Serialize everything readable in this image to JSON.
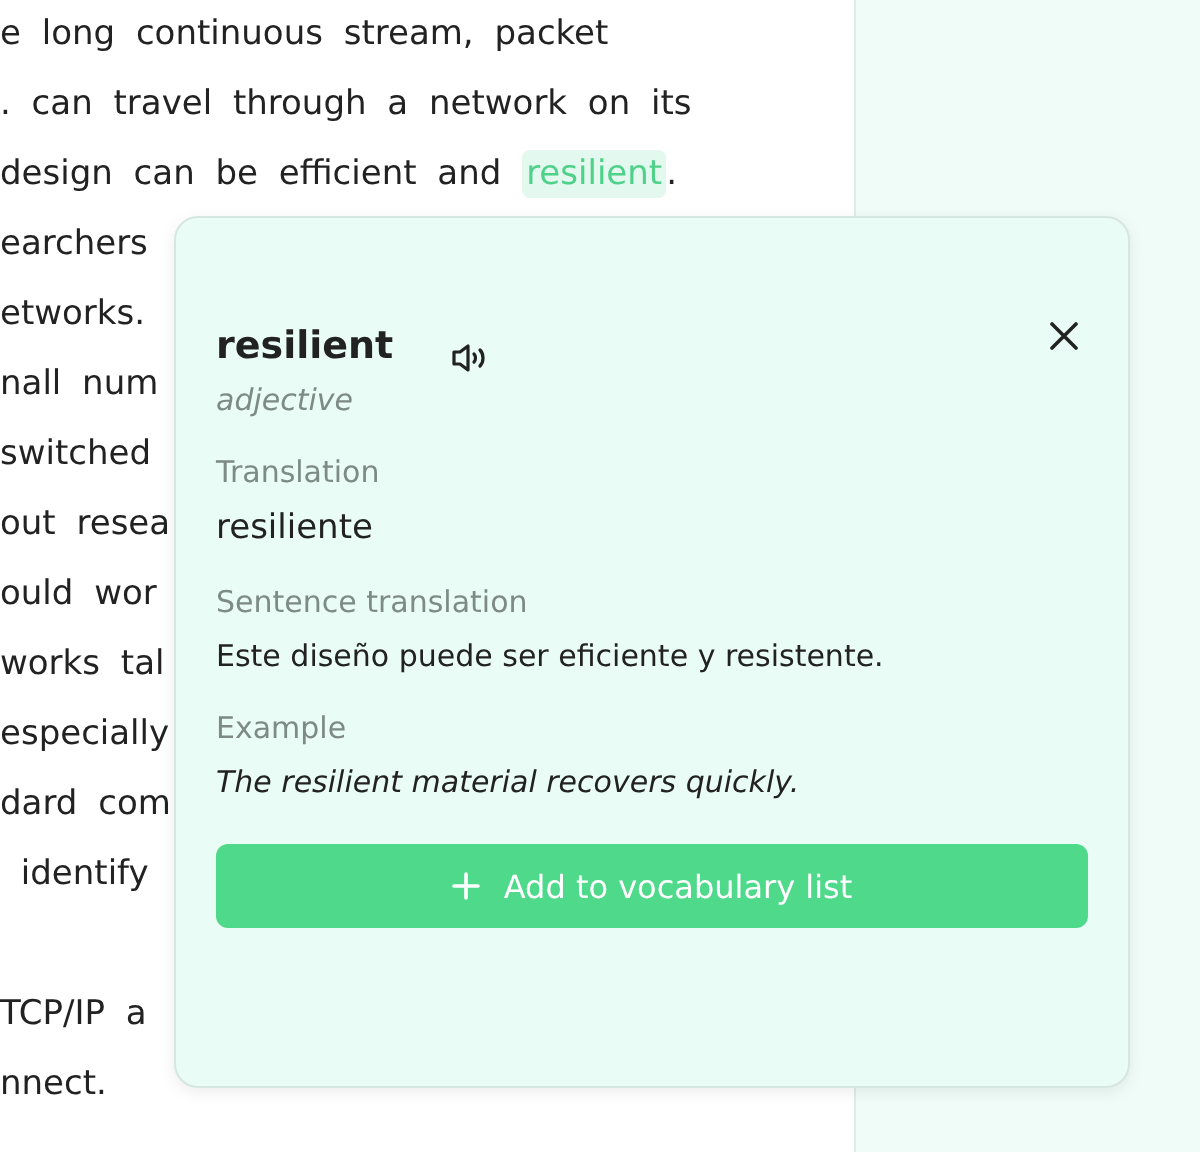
{
  "article": {
    "lines": [
      {
        "text": "e long continuous stream, packet",
        "new_paragraph": false
      },
      {
        "text": ". can travel through a network on its",
        "new_paragraph": false
      },
      {
        "text": "design can be efficient and ",
        "highlight": "resilient",
        "after": ".",
        "new_paragraph": false
      },
      {
        "text": "earchers",
        "new_paragraph": false
      },
      {
        "text": "etworks.",
        "new_paragraph": false
      },
      {
        "text": "nall num",
        "new_paragraph": false
      },
      {
        "text": "switched",
        "new_paragraph": false
      },
      {
        "text": "out resea",
        "new_paragraph": false
      },
      {
        "text": "ould wor",
        "new_paragraph": false
      },
      {
        "text": "works tal",
        "new_paragraph": false
      },
      {
        "text": "especially",
        "new_paragraph": false
      },
      {
        "text": "dard com",
        "new_paragraph": false
      },
      {
        "text": " identify",
        "new_paragraph": false
      },
      {
        "text": "TCP/IP a",
        "new_paragraph": true
      },
      {
        "text": "nnect.",
        "new_paragraph": false
      }
    ]
  },
  "popup": {
    "word": "resilient",
    "part_of_speech": "adjective",
    "sections": [
      {
        "label": "Translation",
        "text": "resiliente",
        "kind": "large"
      },
      {
        "label": "Sentence translation",
        "text": "Este diseño puede ser eficiente y resistente.",
        "kind": "plain"
      },
      {
        "label": "Example",
        "text": "The resilient material recovers quickly.",
        "kind": "italic"
      }
    ],
    "button": "Add to vocabulary list"
  }
}
